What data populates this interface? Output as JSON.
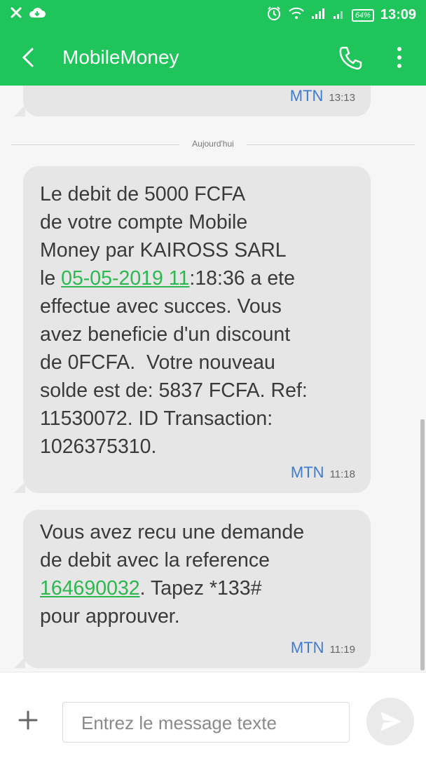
{
  "status_bar": {
    "time": "13:09",
    "battery": "64%",
    "icons": [
      "close-x-icon",
      "cloud-icon",
      "alarm-icon",
      "wifi-icon",
      "signal-icon",
      "signal-icon-2",
      "battery-icon"
    ]
  },
  "app_bar": {
    "title": "MobileMoney",
    "back_icon": "back-chevron-icon",
    "call_icon": "phone-icon",
    "menu_icon": "more-vert-icon"
  },
  "messages": {
    "previous": {
      "sender": "MTN",
      "time": "13:13"
    },
    "day_divider": "Aujourd'hui",
    "msg1": {
      "line1": "Le debit de 5000 FCFA\nde votre compte Mobile\nMoney par KAIROSS SARL\nle ",
      "link": "05-05-2019 11",
      "line2": ":18:36 a ete\neffectue avec succes. Vous\navez beneficie d'un discount\nde 0FCFA.  Votre nouveau\nsolde est de: 5837 FCFA. Ref:\n11530072. ID Transaction:\n1026375310.",
      "sender": "MTN",
      "time": "11:18"
    },
    "msg2": {
      "line1": "Vous avez recu une demande\nde debit avec la reference\n",
      "link": "164690032",
      "line2": ". Tapez *133#\npour approuver.",
      "sender": "MTN",
      "time": "11:19"
    }
  },
  "composer": {
    "placeholder": "Entrez le message texte",
    "attach_icon": "plus-icon",
    "send_icon": "send-icon"
  },
  "colors": {
    "accent": "#1fc45a",
    "bubble": "#e6e6e6",
    "link": "#2db84f",
    "sender": "#3f7bd1"
  }
}
